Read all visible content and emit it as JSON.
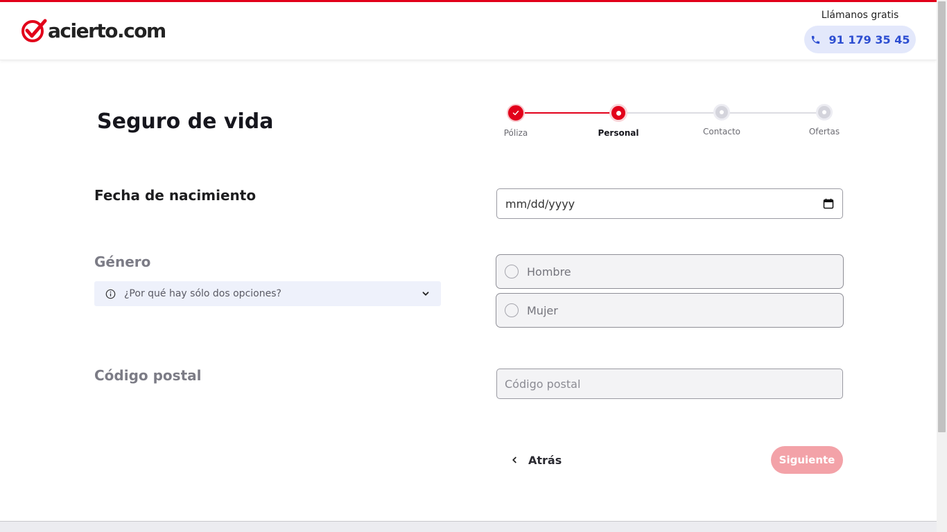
{
  "header": {
    "logo_text": "acierto.com",
    "call_label": "Llámanos gratis",
    "phone_number": "91 179 35 45"
  },
  "page": {
    "title": "Seguro de vida"
  },
  "stepper": {
    "steps": [
      {
        "label": "Póliza",
        "state": "done"
      },
      {
        "label": "Personal",
        "state": "current"
      },
      {
        "label": "Contacto",
        "state": "todo"
      },
      {
        "label": "Ofertas",
        "state": "todo"
      }
    ]
  },
  "form": {
    "birthdate": {
      "label": "Fecha de nacimiento",
      "placeholder": "mm/dd/yyyy"
    },
    "gender": {
      "label": "Género",
      "info_text": "¿Por qué hay sólo dos opciones?",
      "options": [
        "Hombre",
        "Mujer"
      ]
    },
    "postal": {
      "label": "Código postal",
      "placeholder": "Código postal"
    }
  },
  "nav": {
    "back_label": "Atrás",
    "next_label": "Siguiente"
  },
  "colors": {
    "brand_red": "#e2001a",
    "accent_blue": "#2d4ed1",
    "disabled_next": "#f3a2a8"
  }
}
